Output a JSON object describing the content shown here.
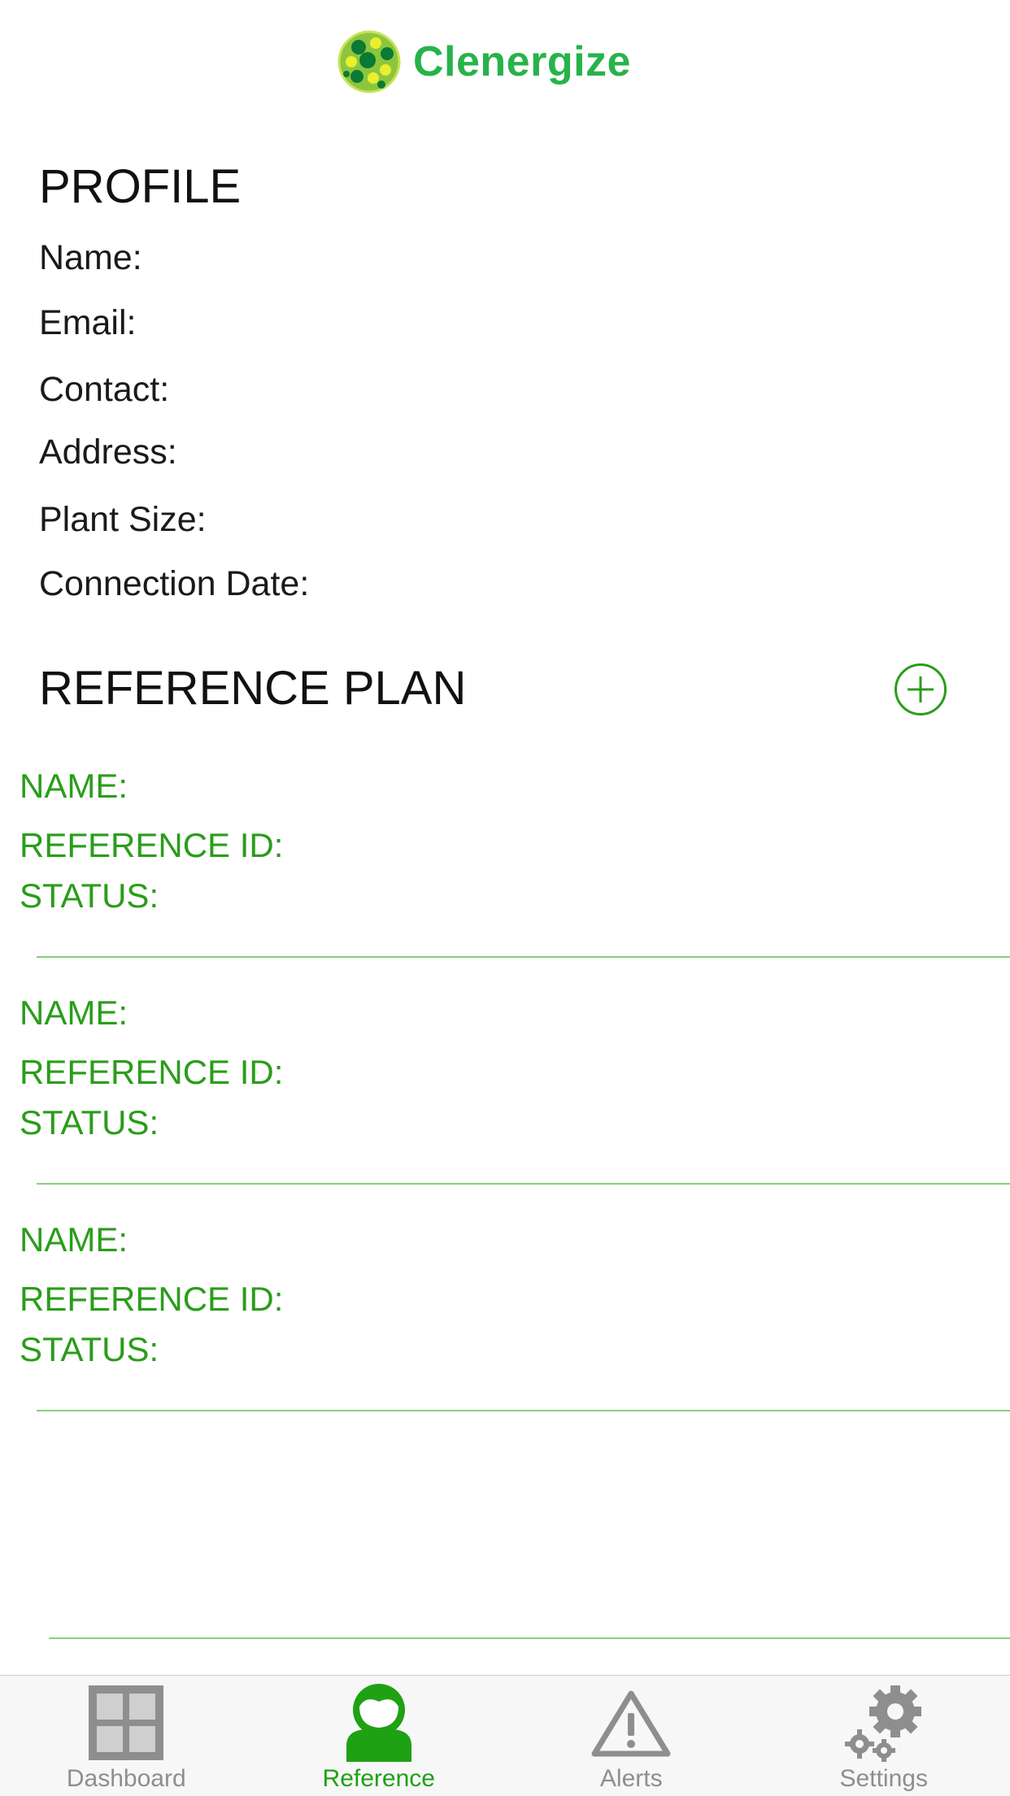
{
  "app": {
    "name": "Clenergize",
    "accent": "#2a9d1a",
    "brand": "#27b34a"
  },
  "profile": {
    "title": "PROFILE",
    "fields": [
      "Name:",
      "Email:",
      "Contact:",
      "Address:",
      "Plant Size:",
      "Connection Date:"
    ]
  },
  "reference_plan": {
    "title": "REFERENCE PLAN",
    "add_icon": "plus-circle-icon",
    "items": [
      {
        "name": "NAME:",
        "reference_id": "REFERENCE ID:",
        "status": "STATUS:"
      },
      {
        "name": "NAME:",
        "reference_id": "REFERENCE ID:",
        "status": "STATUS:"
      },
      {
        "name": "NAME:",
        "reference_id": "REFERENCE ID:",
        "status": "STATUS:"
      }
    ]
  },
  "tabbar": {
    "active": "Reference",
    "tabs": [
      {
        "label": "Dashboard",
        "icon": "dashboard-grid-icon"
      },
      {
        "label": "Reference",
        "icon": "person-icon"
      },
      {
        "label": "Alerts",
        "icon": "warning-triangle-icon"
      },
      {
        "label": "Settings",
        "icon": "gears-icon"
      }
    ]
  }
}
